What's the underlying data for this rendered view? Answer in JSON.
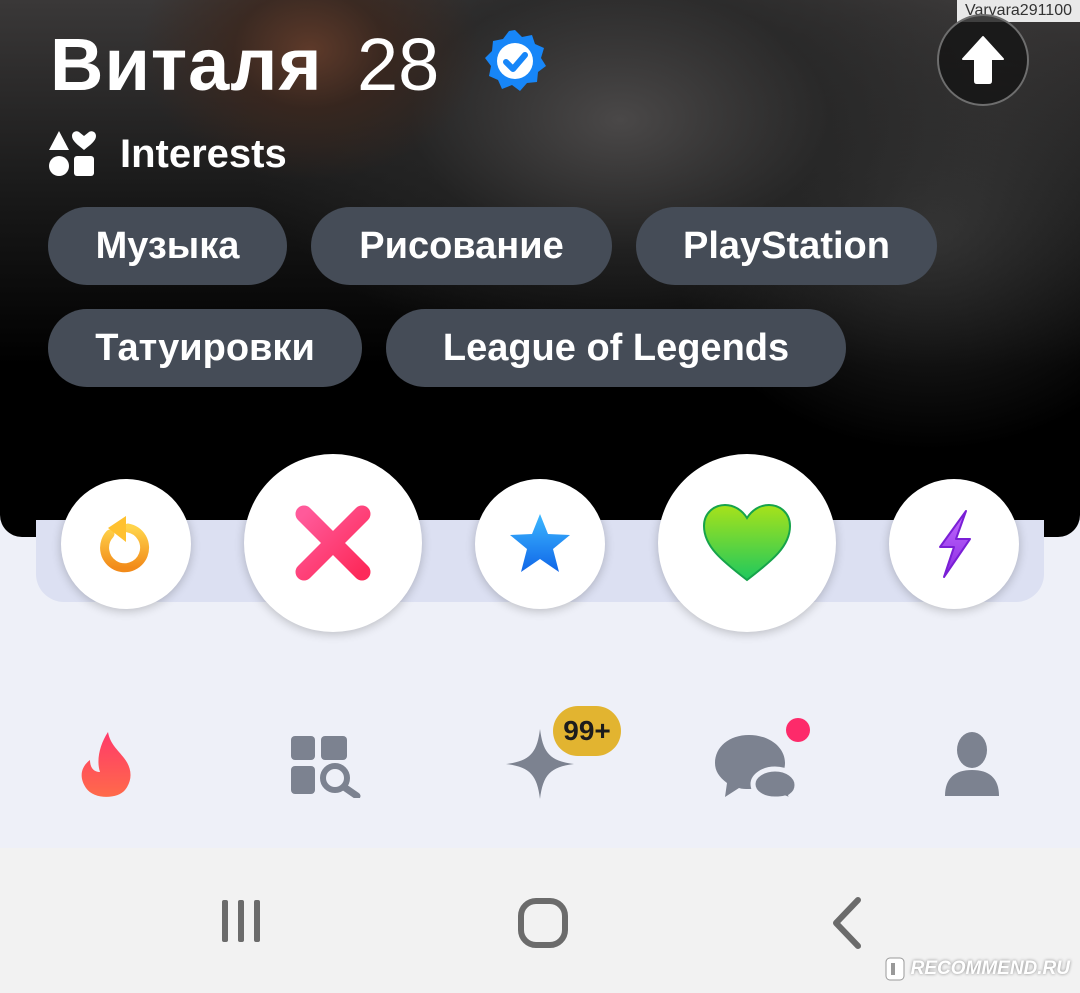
{
  "watermark_user": "Varvara291100",
  "profile": {
    "name": "Виталя",
    "age": "28",
    "verified_icon": "verified-badge-icon"
  },
  "interests": {
    "title": "Interests",
    "items": [
      "Музыка",
      "Рисование",
      "PlayStation",
      "Татуировки",
      "League of Legends"
    ]
  },
  "actions": [
    {
      "name": "rewind",
      "icon": "rewind-icon",
      "color": "#f5a623"
    },
    {
      "name": "nope",
      "icon": "x-icon",
      "color": "#fd267a"
    },
    {
      "name": "super-like",
      "icon": "star-icon",
      "color": "#1e90ff"
    },
    {
      "name": "like",
      "icon": "heart-icon",
      "color": "#4cd41e"
    },
    {
      "name": "boost",
      "icon": "lightning-icon",
      "color": "#a33cff"
    }
  ],
  "nav": {
    "items": [
      "flame-icon",
      "explore-icon",
      "sparkle-icon",
      "messages-icon",
      "profile-icon"
    ],
    "likes_badge": "99+",
    "active_color": "#fd3a5a",
    "inactive_color": "#7c8290"
  },
  "brand_watermark": "RECOMMEND.RU"
}
